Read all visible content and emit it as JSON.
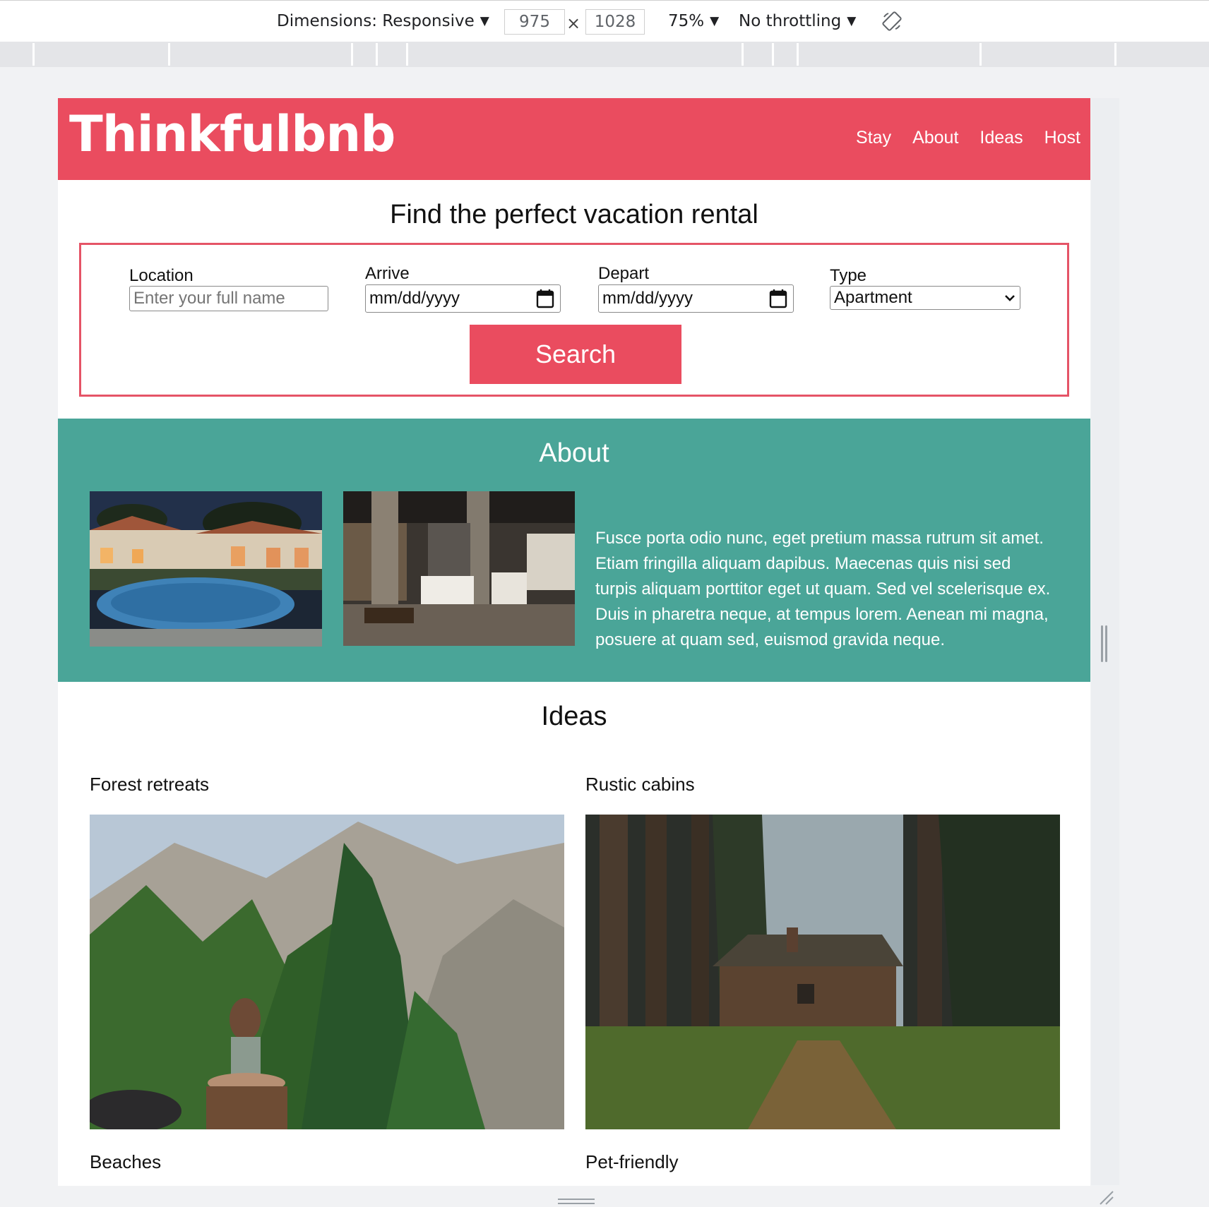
{
  "devtools": {
    "dimensions_label": "Dimensions: Responsive",
    "width_value": "975",
    "times_symbol": "×",
    "height_value": "1028",
    "zoom_label": "75%",
    "throttling_label": "No throttling",
    "caret": "▼"
  },
  "site": {
    "logo": "Thinkfulbnb",
    "nav": [
      "Stay",
      "About",
      "Ideas",
      "Host"
    ],
    "brand_color": "#ea4c5f",
    "about_color": "#4aa598"
  },
  "search": {
    "title": "Find the perfect vacation rental",
    "location_label": "Location",
    "location_placeholder": "Enter your full name",
    "arrive_label": "Arrive",
    "arrive_value": "mm/dd/yyyy",
    "depart_label": "Depart",
    "depart_value": "mm/dd/yyyy",
    "type_label": "Type",
    "type_value": "Apartment",
    "button": "Search"
  },
  "about": {
    "title": "About",
    "text": "Fusce porta odio nunc, eget pretium massa rutrum sit amet. Etiam fringilla aliquam dapibus. Maecenas quis nisi sed turpis aliquam porttitor eget ut quam. Sed vel scelerisque ex. Duis in pharetra neque, at tempus lorem. Aenean mi magna, posuere at quam sed, euismod gravida neque."
  },
  "ideas": {
    "title": "Ideas",
    "items": [
      {
        "label": "Forest retreats"
      },
      {
        "label": "Rustic cabins"
      },
      {
        "label": "Beaches"
      },
      {
        "label": "Pet-friendly"
      }
    ]
  }
}
